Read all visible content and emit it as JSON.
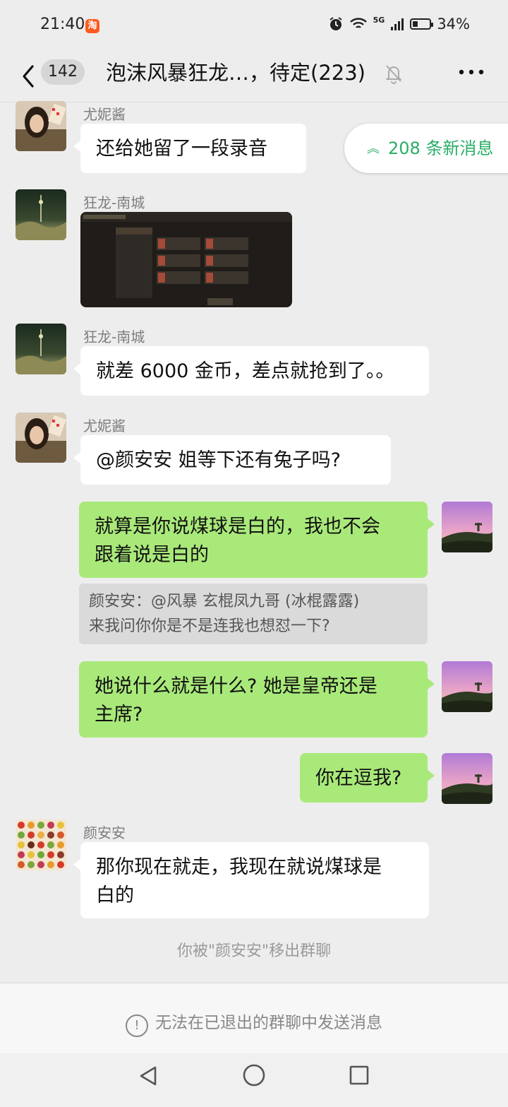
{
  "status_bar": {
    "time": "21:40",
    "taobao_badge": "淘",
    "network": "5G",
    "battery_percent": "34%",
    "battery_level": 0.34
  },
  "header": {
    "unread_count": "142",
    "title": "泡沫风暴狂龙…，待定(223)"
  },
  "new_messages_pill": "208 条新消息",
  "messages": [
    {
      "sender": "尤妮酱",
      "text": "还给她留了一段录音"
    },
    {
      "sender": "狂龙-南城"
    },
    {
      "sender": "狂龙-南城",
      "text": "就差 6000 金币，差点就抢到了。。"
    },
    {
      "sender": "尤妮酱",
      "text": "@颜安安  姐等下还有兔子吗?"
    },
    {
      "text_line1": "就算是你说煤球是白的，我也不会",
      "text_line2": "跟着说是白的"
    },
    {
      "quote_line1": "颜安安：@风暴  玄棍凤九哥 (冰棍露露)",
      "quote_line2": "来我问你你是不是连我也想怼一下?"
    },
    {
      "text_line1": "她说什么就是什么? 她是皇帝还是",
      "text_line2": "主席?"
    },
    {
      "text": "你在逗我?"
    },
    {
      "sender": "颜安安",
      "text_line1": "那你现在就走，我现在就说煤球是",
      "text_line2": "白的"
    }
  ],
  "system_notice": "你被\"颜安安\"移出群聊",
  "input_disabled_notice": "无法在已退出的群聊中发送消息",
  "colors": {
    "background": "#ededed",
    "my_bubble": "#a9e97a",
    "their_bubble": "#ffffff",
    "accent_green": "#2aae67"
  }
}
